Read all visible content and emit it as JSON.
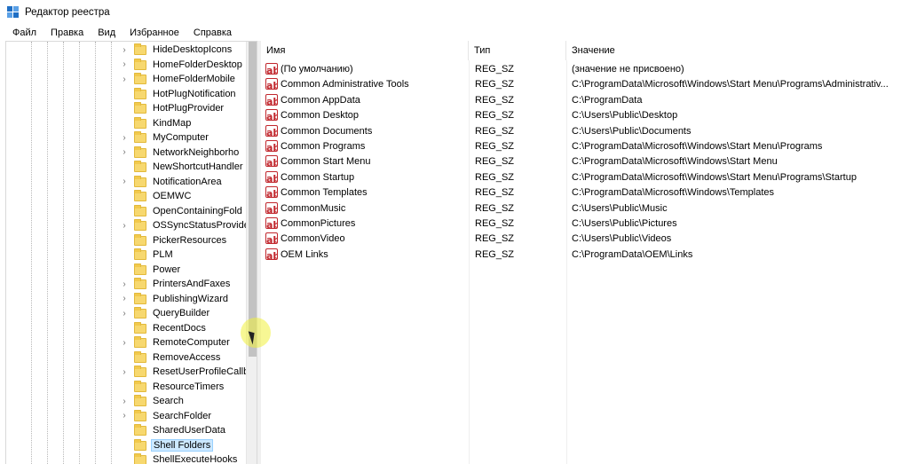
{
  "window": {
    "title": "Редактор реестра"
  },
  "menu": [
    "Файл",
    "Правка",
    "Вид",
    "Избранное",
    "Справка"
  ],
  "tree": {
    "items": [
      {
        "label": "HideDesktopIcons",
        "expandable": true
      },
      {
        "label": "HomeFolderDesktop",
        "expandable": true
      },
      {
        "label": "HomeFolderMobile",
        "expandable": true
      },
      {
        "label": "HotPlugNotification",
        "expandable": false
      },
      {
        "label": "HotPlugProvider",
        "expandable": false
      },
      {
        "label": "KindMap",
        "expandable": false
      },
      {
        "label": "MyComputer",
        "expandable": true
      },
      {
        "label": "NetworkNeighborho",
        "expandable": true
      },
      {
        "label": "NewShortcutHandler",
        "expandable": false
      },
      {
        "label": "NotificationArea",
        "expandable": true
      },
      {
        "label": "OEMWC",
        "expandable": false
      },
      {
        "label": "OpenContainingFold",
        "expandable": false
      },
      {
        "label": "OSSyncStatusProvide",
        "expandable": true
      },
      {
        "label": "PickerResources",
        "expandable": false
      },
      {
        "label": "PLM",
        "expandable": false
      },
      {
        "label": "Power",
        "expandable": false
      },
      {
        "label": "PrintersAndFaxes",
        "expandable": true
      },
      {
        "label": "PublishingWizard",
        "expandable": true
      },
      {
        "label": "QueryBuilder",
        "expandable": true
      },
      {
        "label": "RecentDocs",
        "expandable": false
      },
      {
        "label": "RemoteComputer",
        "expandable": true
      },
      {
        "label": "RemoveAccess",
        "expandable": false
      },
      {
        "label": "ResetUserProfileCallb",
        "expandable": true
      },
      {
        "label": "ResourceTimers",
        "expandable": false
      },
      {
        "label": "Search",
        "expandable": true
      },
      {
        "label": "SearchFolder",
        "expandable": true
      },
      {
        "label": "SharedUserData",
        "expandable": false
      },
      {
        "label": "Shell Folders",
        "expandable": false,
        "selected": true
      },
      {
        "label": "ShellExecuteHooks",
        "expandable": false
      }
    ]
  },
  "values": {
    "columns": {
      "name": "Имя",
      "type": "Тип",
      "data": "Значение"
    },
    "rows": [
      {
        "name": "(По умолчанию)",
        "type": "REG_SZ",
        "data": "(значение не присвоено)"
      },
      {
        "name": "Common Administrative Tools",
        "type": "REG_SZ",
        "data": "C:\\ProgramData\\Microsoft\\Windows\\Start Menu\\Programs\\Administrativ..."
      },
      {
        "name": "Common AppData",
        "type": "REG_SZ",
        "data": "C:\\ProgramData"
      },
      {
        "name": "Common Desktop",
        "type": "REG_SZ",
        "data": "C:\\Users\\Public\\Desktop"
      },
      {
        "name": "Common Documents",
        "type": "REG_SZ",
        "data": "C:\\Users\\Public\\Documents"
      },
      {
        "name": "Common Programs",
        "type": "REG_SZ",
        "data": "C:\\ProgramData\\Microsoft\\Windows\\Start Menu\\Programs"
      },
      {
        "name": "Common Start Menu",
        "type": "REG_SZ",
        "data": "C:\\ProgramData\\Microsoft\\Windows\\Start Menu"
      },
      {
        "name": "Common Startup",
        "type": "REG_SZ",
        "data": "C:\\ProgramData\\Microsoft\\Windows\\Start Menu\\Programs\\Startup"
      },
      {
        "name": "Common Templates",
        "type": "REG_SZ",
        "data": "C:\\ProgramData\\Microsoft\\Windows\\Templates"
      },
      {
        "name": "CommonMusic",
        "type": "REG_SZ",
        "data": "C:\\Users\\Public\\Music"
      },
      {
        "name": "CommonPictures",
        "type": "REG_SZ",
        "data": "C:\\Users\\Public\\Pictures"
      },
      {
        "name": "CommonVideo",
        "type": "REG_SZ",
        "data": "C:\\Users\\Public\\Videos"
      },
      {
        "name": "OEM Links",
        "type": "REG_SZ",
        "data": "C:\\ProgramData\\OEM\\Links"
      }
    ]
  },
  "icons": {
    "app": "registry-editor-icon",
    "tree_item": "folder-icon",
    "expander": "chevron-right-icon",
    "value": "string-value-icon",
    "value_glyph": "ab"
  },
  "colors": {
    "selection": "#cce8ff",
    "folder": "#f7d86f",
    "value_icon": "#c1272d"
  }
}
